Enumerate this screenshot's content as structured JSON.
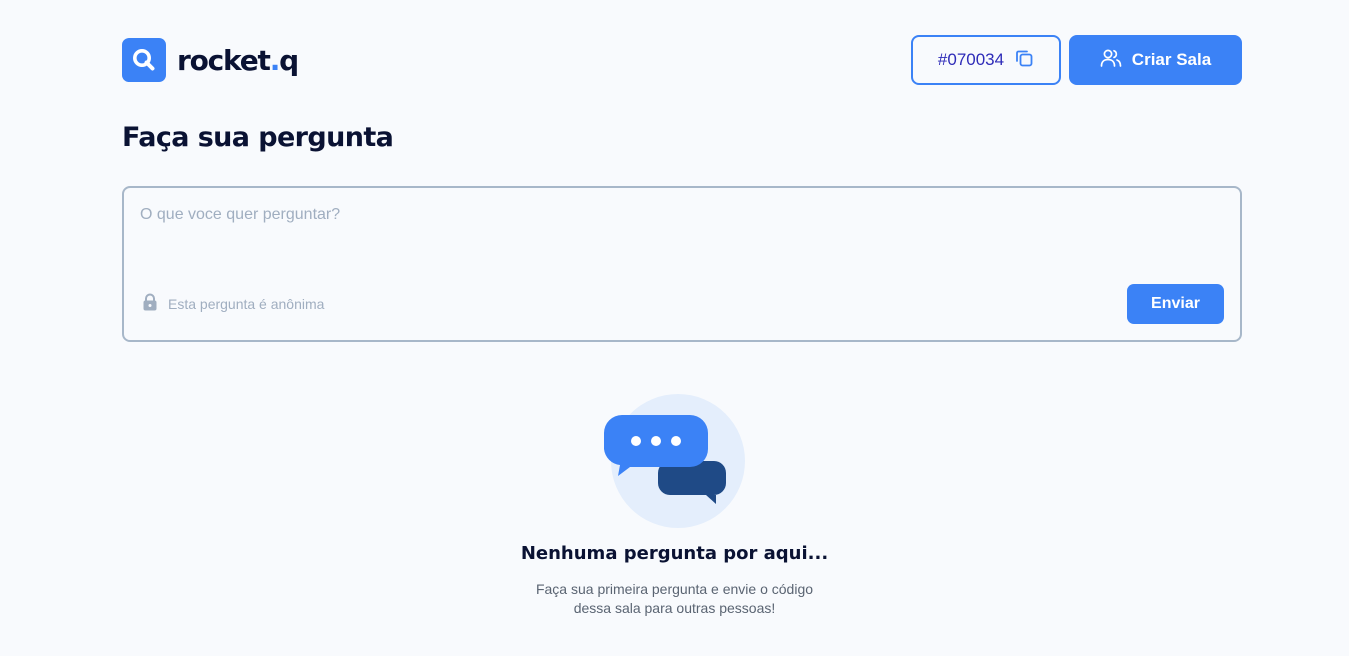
{
  "header": {
    "logo": {
      "icon": "search-magnifier-icon",
      "text_main": "rocket",
      "text_dot": ".",
      "text_end": "q",
      "brand_color": "#3b82f6"
    },
    "room_code": {
      "label": "#070034",
      "icon": "copy-icon"
    },
    "create_room": {
      "label": "Criar Sala",
      "icon": "users-icon"
    }
  },
  "page": {
    "title": "Faça sua pergunta"
  },
  "question_form": {
    "placeholder": "O que voce quer perguntar?",
    "value": "",
    "anonymous_label": "Esta pergunta é anônima",
    "anonymous_icon": "lock-icon",
    "submit_label": "Enviar"
  },
  "empty_state": {
    "icon": "chat-bubbles-icon",
    "title": "Nenhuma pergunta por aqui...",
    "description": "Faça sua primeira pergunta e envie o código dessa sala para outras pessoas!"
  },
  "colors": {
    "accent": "#3b82f6",
    "text_dark": "#0a1233",
    "muted": "#a0aec0",
    "bubble_dark": "#1f4a86",
    "bubble_bg": "#e4eefc"
  }
}
